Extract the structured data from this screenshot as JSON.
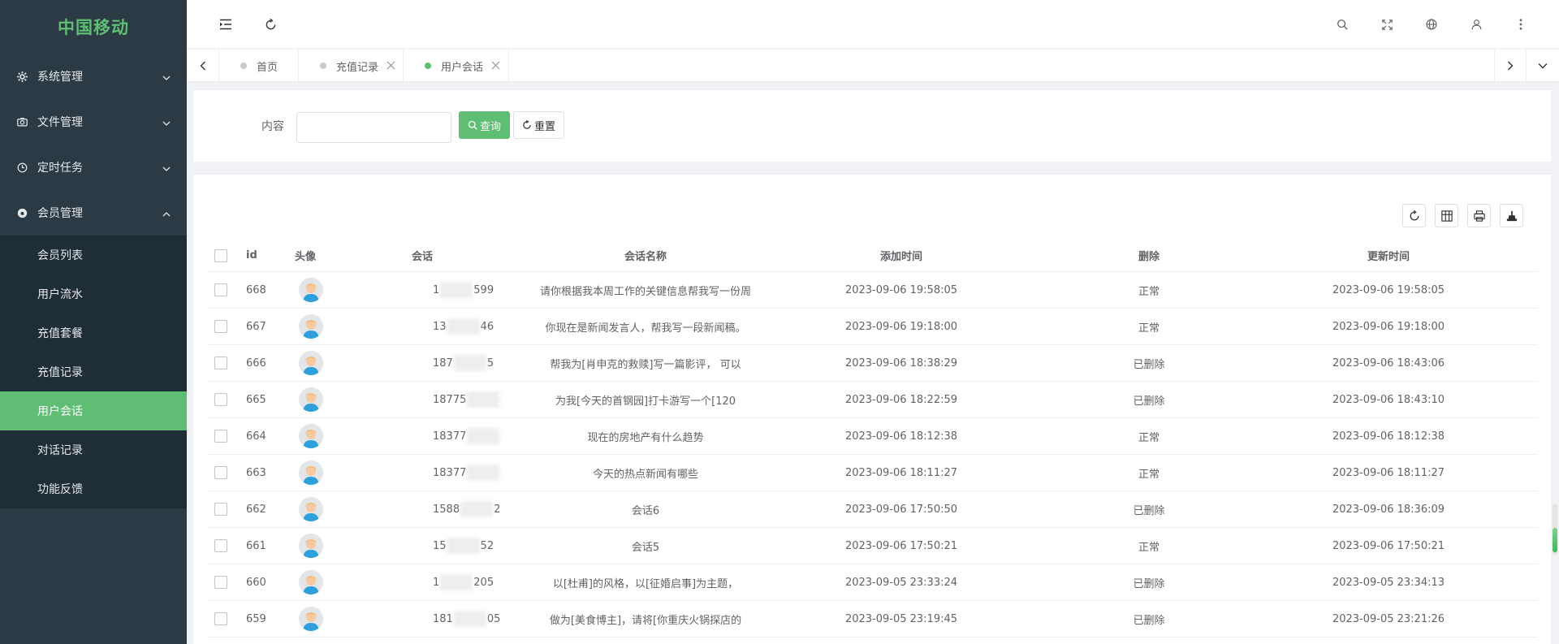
{
  "brand": "中国移动",
  "sidebar": {
    "menus": [
      {
        "label": "系统管理",
        "icon": "gear-icon"
      },
      {
        "label": "文件管理",
        "icon": "camera-icon"
      },
      {
        "label": "定时任务",
        "icon": "clock-icon"
      },
      {
        "label": "会员管理",
        "icon": "eye-icon"
      }
    ],
    "submenu": [
      {
        "label": "会员列表"
      },
      {
        "label": "用户流水"
      },
      {
        "label": "充值套餐"
      },
      {
        "label": "充值记录"
      },
      {
        "label": "用户会话"
      },
      {
        "label": "对话记录"
      },
      {
        "label": "功能反馈"
      }
    ]
  },
  "header": {
    "icons": [
      "menu-fold-icon",
      "refresh-icon",
      "search-icon",
      "fullscreen-icon",
      "globe-icon",
      "user-icon",
      "more-icon"
    ]
  },
  "tabs": [
    {
      "label": "首页"
    },
    {
      "label": "充值记录"
    },
    {
      "label": "用户会话"
    }
  ],
  "search": {
    "label": "内容",
    "value": "",
    "query_btn": "查询",
    "reset_btn": "重置"
  },
  "table": {
    "tools": [
      "refresh-icon",
      "columns-icon",
      "print-icon",
      "export-icon"
    ],
    "columns": [
      "id",
      "头像",
      "会话",
      "会话名称",
      "添加时间",
      "删除",
      "更新时间"
    ],
    "rows": [
      {
        "id": "668",
        "session": "1",
        "session_tail": "599",
        "name": "请你根据我本周工作的关键信息帮我写一份周",
        "added": "2023-09-06 19:58:05",
        "deleted": "正常",
        "updated": "2023-09-06 19:58:05"
      },
      {
        "id": "667",
        "session": "13",
        "session_tail": "46",
        "name": "你现在是新闻发言人，帮我写一段新闻稿。",
        "added": "2023-09-06 19:18:00",
        "deleted": "正常",
        "updated": "2023-09-06 19:18:00"
      },
      {
        "id": "666",
        "session": "187",
        "session_tail": "5",
        "name": "帮我为[肖申克的救赎]写一篇影评， 可以",
        "added": "2023-09-06 18:38:29",
        "deleted": "已删除",
        "updated": "2023-09-06 18:43:06"
      },
      {
        "id": "665",
        "session": "18775",
        "session_tail": "",
        "name": "为我[今天的首钢园]打卡游写一个[120",
        "added": "2023-09-06 18:22:59",
        "deleted": "已删除",
        "updated": "2023-09-06 18:43:10"
      },
      {
        "id": "664",
        "session": "18377",
        "session_tail": "",
        "name": "现在的房地产有什么趋势",
        "added": "2023-09-06 18:12:38",
        "deleted": "正常",
        "updated": "2023-09-06 18:12:38"
      },
      {
        "id": "663",
        "session": "18377",
        "session_tail": "",
        "name": "今天的热点新闻有哪些",
        "added": "2023-09-06 18:11:27",
        "deleted": "正常",
        "updated": "2023-09-06 18:11:27"
      },
      {
        "id": "662",
        "session": "1588",
        "session_tail": "2",
        "name": "会话6",
        "added": "2023-09-06 17:50:50",
        "deleted": "已删除",
        "updated": "2023-09-06 18:36:09"
      },
      {
        "id": "661",
        "session": "15",
        "session_tail": "52",
        "name": "会话5",
        "added": "2023-09-06 17:50:21",
        "deleted": "正常",
        "updated": "2023-09-06 17:50:21"
      },
      {
        "id": "660",
        "session": "1",
        "session_tail": "205",
        "name": "以[杜甫]的风格，以[征婚启事]为主题，",
        "added": "2023-09-05 23:33:24",
        "deleted": "已删除",
        "updated": "2023-09-05 23:34:13"
      },
      {
        "id": "659",
        "session": "181",
        "session_tail": "05",
        "name": "做为[美食博主]，请将[你重庆火锅探店的",
        "added": "2023-09-05 23:19:45",
        "deleted": "已删除",
        "updated": "2023-09-05 23:21:26"
      }
    ]
  }
}
